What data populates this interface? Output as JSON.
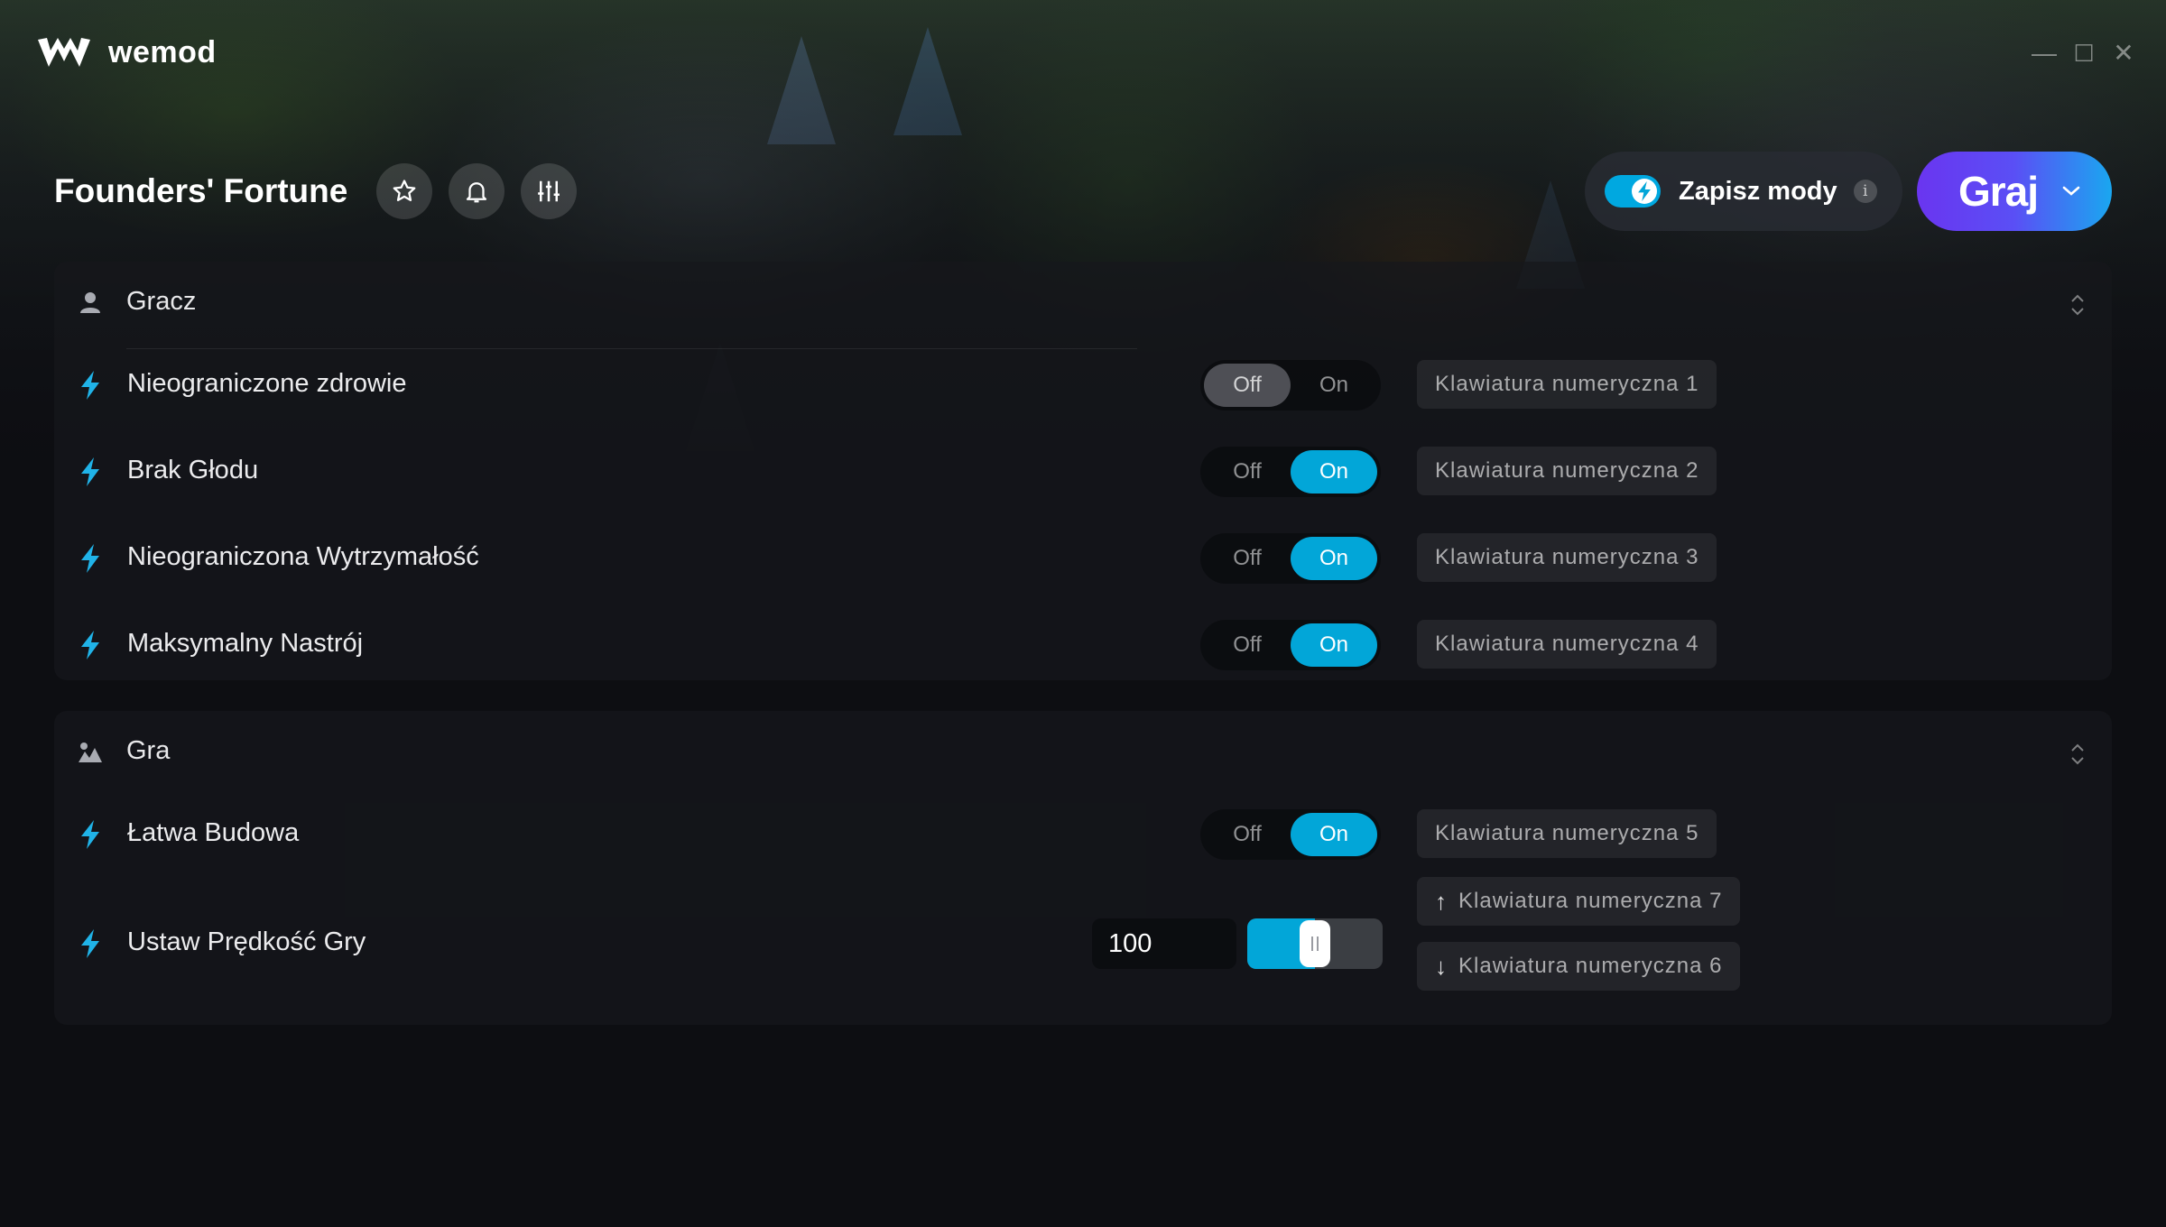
{
  "app": {
    "name": "wemod"
  },
  "window_controls": {
    "minimize": "—",
    "maximize": "☐",
    "close": "✕"
  },
  "game": {
    "title": "Founders' Fortune"
  },
  "header_buttons": [
    "star-icon",
    "bell-icon",
    "sliders-icon"
  ],
  "save_mods": {
    "label": "Zapisz mody",
    "enabled": true,
    "info": "i"
  },
  "play": {
    "label": "Graj"
  },
  "colors": {
    "accent": "#02a6d8",
    "play_start": "#6a35f0",
    "play_end": "#1aa7f0"
  },
  "sections": [
    {
      "title": "Gracz",
      "icon": "user-icon",
      "mods": [
        {
          "label": "Nieograniczone zdrowie",
          "off": "Off",
          "on": "On",
          "state": "off",
          "hotkey": "Klawiatura numeryczna 1"
        },
        {
          "label": "Brak Głodu",
          "off": "Off",
          "on": "On",
          "state": "on",
          "hotkey": "Klawiatura numeryczna 2"
        },
        {
          "label": "Nieograniczona Wytrzymałość",
          "off": "Off",
          "on": "On",
          "state": "on",
          "hotkey": "Klawiatura numeryczna 3"
        },
        {
          "label": "Maksymalny Nastrój",
          "off": "Off",
          "on": "On",
          "state": "on",
          "hotkey": "Klawiatura numeryczna 4"
        }
      ]
    },
    {
      "title": "Gra",
      "icon": "landscape-icon",
      "mods": [
        {
          "label": "Łatwa Budowa",
          "off": "Off",
          "on": "On",
          "state": "on",
          "hotkey": "Klawiatura numeryczna 5"
        }
      ],
      "slider_mod": {
        "label": "Ustaw Prędkość Gry",
        "value": "100",
        "slider_fraction": 0.5,
        "hotkey_up": "Klawiatura numeryczna 7",
        "hotkey_down": "Klawiatura numeryczna 6"
      }
    }
  ]
}
